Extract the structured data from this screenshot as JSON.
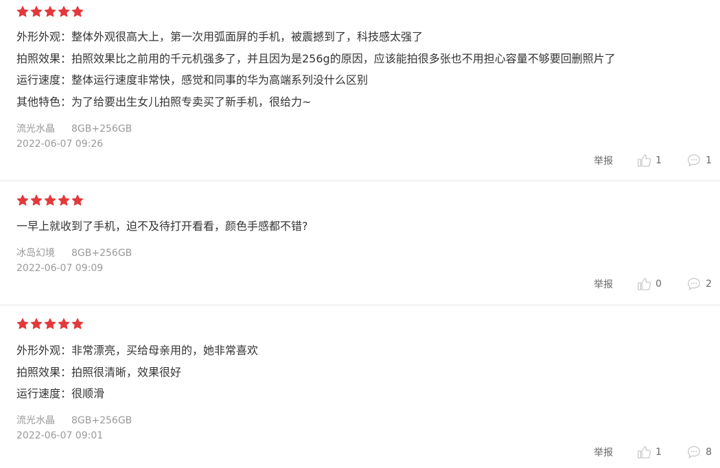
{
  "reviews": [
    {
      "rating": 5,
      "lines": [
        "外形外观：整体外观很高大上，第一次用弧面屏的手机，被震撼到了，科技感太强了",
        "拍照效果：拍照效果比之前用的千元机强多了，并且因为是256g的原因，应该能拍很多张也不用担心容量不够要回删照片了",
        "运行速度：整体运行速度非常快，感觉和同事的华为高端系列没什么区别",
        "其他特色：为了给要出生女儿拍照专卖买了新手机，很给力~"
      ],
      "color": "流光水晶",
      "variant": "8GB+256GB",
      "date": "2022-06-07 09:26",
      "report_label": "举报",
      "likes": "1",
      "comments": "1"
    },
    {
      "rating": 5,
      "lines": [
        "一早上就收到了手机，迫不及待打开看看，颜色手感都不错?"
      ],
      "color": "冰岛幻境",
      "variant": "8GB+256GB",
      "date": "2022-06-07 09:09",
      "report_label": "举报",
      "likes": "0",
      "comments": "2"
    },
    {
      "rating": 5,
      "lines": [
        "外形外观：非常漂亮，买给母亲用的，她非常喜欢",
        "拍照效果：拍照很清晰，效果很好",
        "运行速度：很顺滑"
      ],
      "color": "流光水晶",
      "variant": "8GB+256GB",
      "date": "2022-06-07 09:01",
      "report_label": "举报",
      "likes": "1",
      "comments": "8"
    }
  ],
  "colors": {
    "star": "#e4393c",
    "text": "#333333",
    "meta": "#999999",
    "icon": "#c8c8c8"
  },
  "icons": {
    "star": "star-icon",
    "like": "thumbs-up-icon",
    "comment": "comment-bubble-icon"
  }
}
